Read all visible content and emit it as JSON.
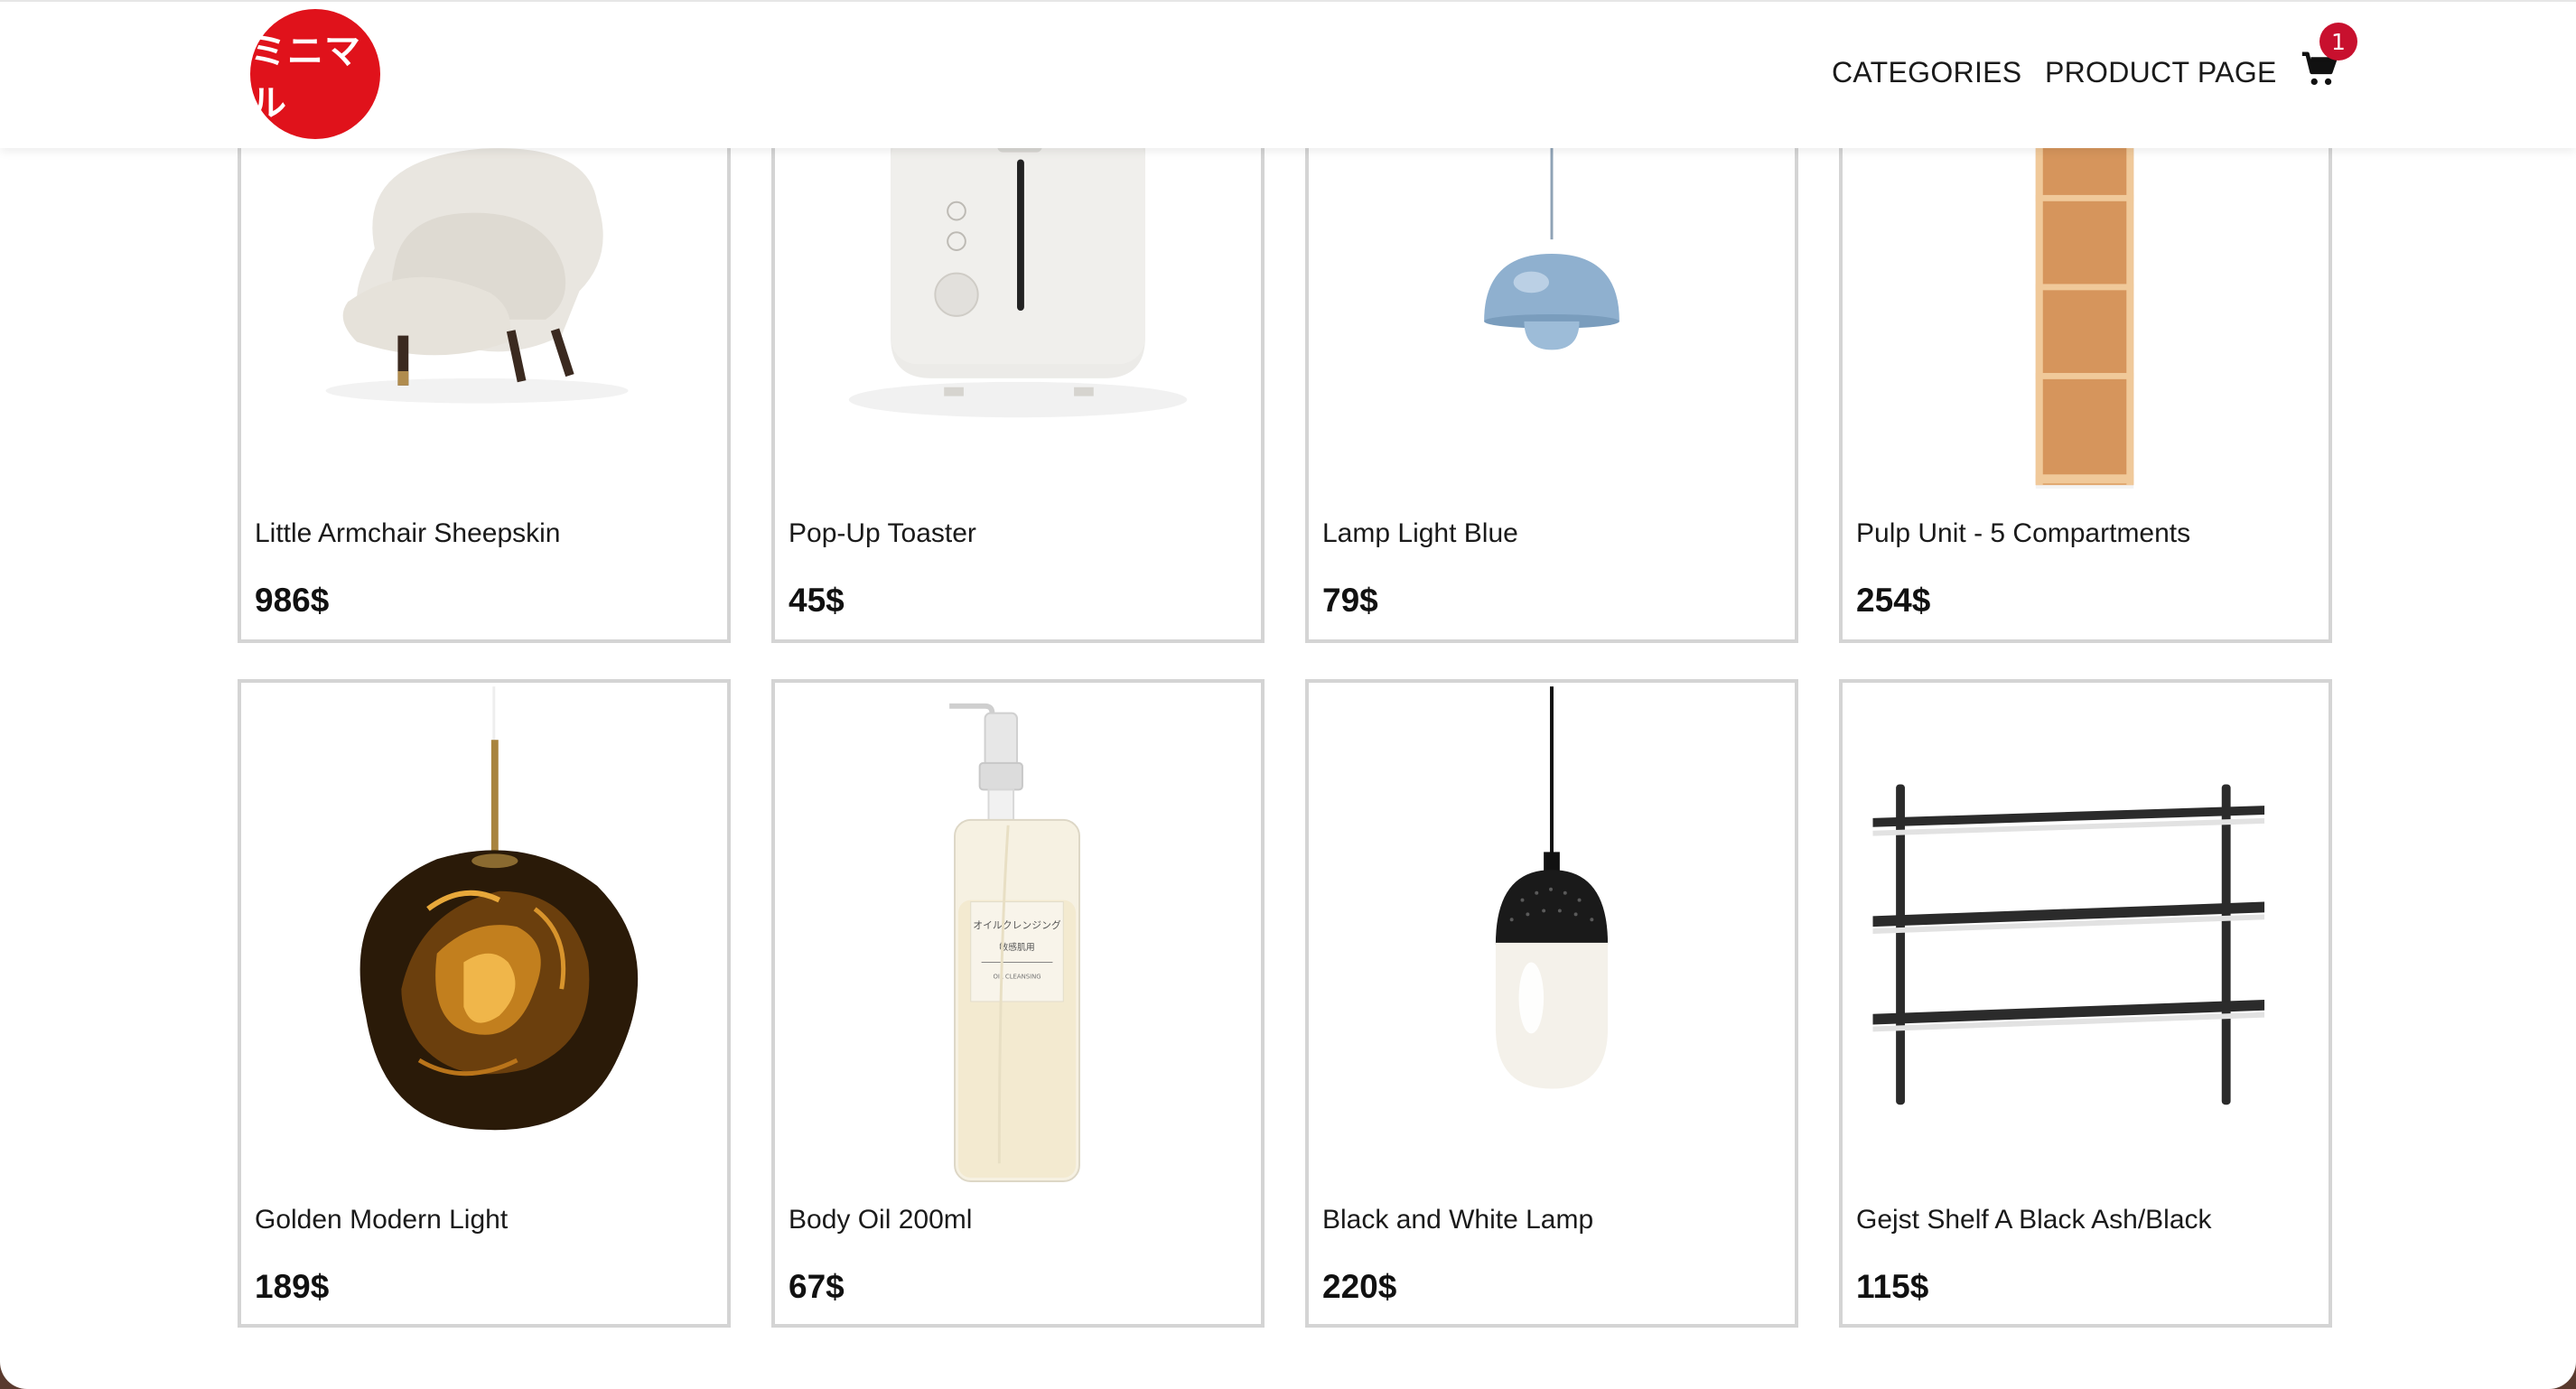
{
  "header": {
    "logo_text": "ミニマル",
    "nav": [
      {
        "label": "CATEGORIES"
      },
      {
        "label": "PRODUCT PAGE"
      }
    ],
    "cart_count": "1",
    "cart_icon": "cart-icon"
  },
  "colors": {
    "brand_red": "#e0121b",
    "badge_red": "#c8102e",
    "card_border": "#d4d4d4"
  },
  "products": [
    {
      "name": "Little Armchair Sheepskin",
      "price": "986$",
      "image": "armchair"
    },
    {
      "name": "Pop-Up Toaster",
      "price": "45$",
      "image": "toaster"
    },
    {
      "name": "Lamp Light Blue",
      "price": "79$",
      "image": "blue-pendant-lamp"
    },
    {
      "name": "Pulp Unit - 5 Compartments",
      "price": "254$",
      "image": "shelf-unit"
    },
    {
      "name": "Golden Modern Light",
      "price": "189$",
      "image": "golden-pendant"
    },
    {
      "name": "Body Oil 200ml",
      "price": "67$",
      "image": "oil-bottle"
    },
    {
      "name": "Black and White Lamp",
      "price": "220$",
      "image": "black-white-lamp"
    },
    {
      "name": "Gejst Shelf A Black Ash/Black",
      "price": "115$",
      "image": "wall-shelf"
    }
  ],
  "bottle_label": {
    "line1": "オイルクレンジング",
    "line2": "敏感肌用",
    "line3": "OIL CLEANSING"
  }
}
